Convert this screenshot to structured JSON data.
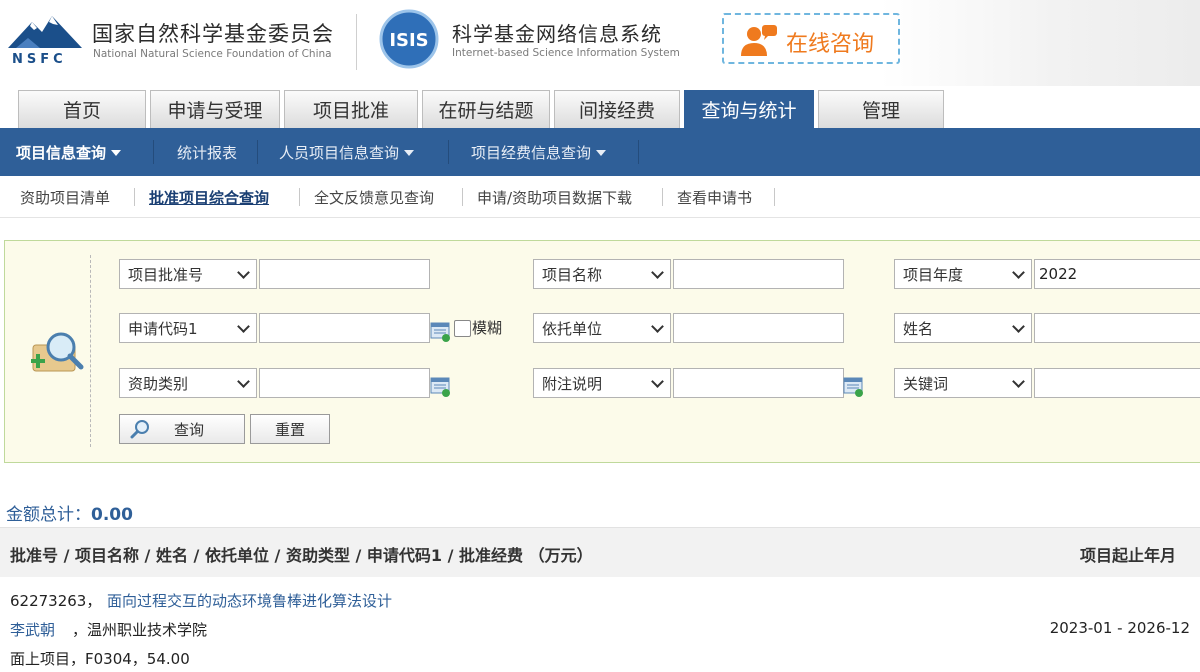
{
  "header": {
    "org_cn": "国家自然科学基金委员会",
    "org_en": "National Natural Science Foundation of China",
    "org_abbr": "NSFC",
    "system_cn": "科学基金网络信息系统",
    "system_en": "Internet-based Science Information System",
    "logo_text": "ISIS",
    "consult_label": "在线咨询"
  },
  "tabs": [
    {
      "label": "首页"
    },
    {
      "label": "申请与受理"
    },
    {
      "label": "项目批准"
    },
    {
      "label": "在研与结题"
    },
    {
      "label": "间接经费"
    },
    {
      "label": "查询与统计",
      "active": true
    },
    {
      "label": "管理"
    }
  ],
  "subnav": [
    {
      "label": "项目信息查询",
      "active": true,
      "dropdown": true
    },
    {
      "label": "统计报表"
    },
    {
      "label": "人员项目信息查询",
      "dropdown": true
    },
    {
      "label": "项目经费信息查询",
      "dropdown": true
    }
  ],
  "thirdnav": [
    {
      "label": "资助项目清单"
    },
    {
      "label": "批准项目综合查询",
      "active": true
    },
    {
      "label": "全文反馈意见查询"
    },
    {
      "label": "申请/资助项目数据下载"
    },
    {
      "label": "查看申请书"
    }
  ],
  "search": {
    "fields": [
      {
        "select": "项目批准号",
        "value": ""
      },
      {
        "select": "项目名称",
        "value": ""
      },
      {
        "select": "项目年度",
        "value": "2022"
      },
      {
        "select": "申请代码1",
        "value": ""
      },
      {
        "select": "依托单位",
        "value": ""
      },
      {
        "select": "姓名",
        "value": ""
      },
      {
        "select": "资助类别",
        "value": ""
      },
      {
        "select": "附注说明",
        "value": ""
      },
      {
        "select": "关键词",
        "value": ""
      }
    ],
    "fuzzy_label": "模糊",
    "query_label": "查询",
    "reset_label": "重置"
  },
  "results": {
    "total_label": "金额总计：",
    "total_value": "0.00",
    "header_left": "批准号 / 项目名称 / 姓名 / 依托单位 / 资助类型 / 申请代码1 / 批准经费 （万元）",
    "header_right": "项目起止年月",
    "rows": [
      {
        "approval_no": "62273263，",
        "title": "面向过程交互的动态环境鲁棒进化算法设计",
        "person": "李武朝",
        "unit": "，温州职业技术学院",
        "detail": "面上项目，F0304，54.00",
        "period": "2023-01 - 2026-12"
      }
    ]
  },
  "colors": {
    "nav_blue": "#2f5f98",
    "accent_orange": "#ef7a1e",
    "panel_bg": "#fcfbea",
    "panel_border": "#bfd99b"
  }
}
